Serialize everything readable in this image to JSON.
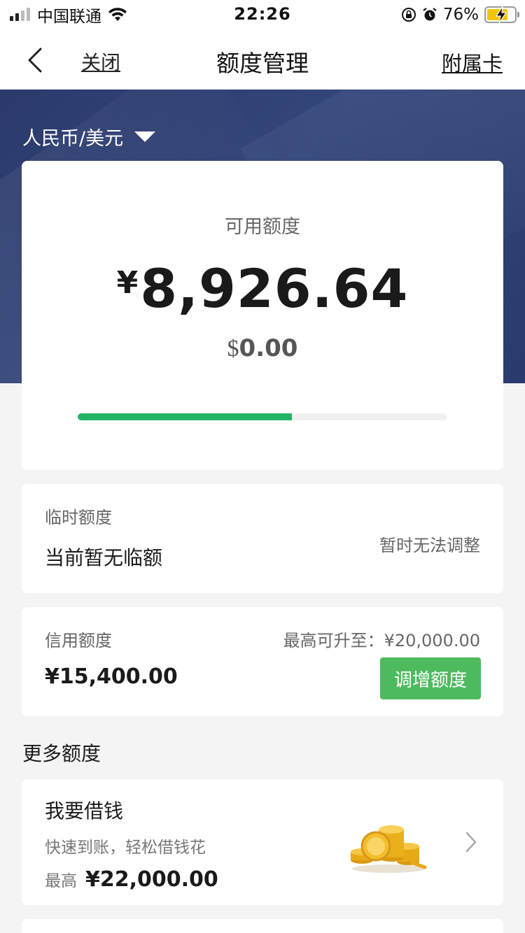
{
  "status_bar": {
    "carrier": "中国联通",
    "time": "22:26",
    "battery_percent": "76%",
    "battery_level": 0.76,
    "icons": [
      "signal-icon",
      "wifi-icon",
      "orientation-lock-icon",
      "alarm-icon",
      "battery-charging-icon"
    ]
  },
  "nav": {
    "close_label": "关闭",
    "title": "额度管理",
    "sub_card_label": "附属卡"
  },
  "hero": {
    "currency_label": "人民币/美元"
  },
  "available": {
    "label": "可用额度",
    "yen_symbol": "¥",
    "amount": "8,926.64",
    "usd_symbol": "$",
    "usd_amount": "0.00",
    "used_fraction": 0.58
  },
  "temporary": {
    "label": "临时额度",
    "value": "当前暂无临额",
    "status": "暂时无法调整"
  },
  "credit": {
    "label": "信用额度",
    "value": "¥15,400.00",
    "max_raise": "最高可升至：¥20,000.00",
    "raise_button": "调增额度"
  },
  "more": {
    "section_title": "更多额度",
    "loan_title": "我要借钱",
    "loan_subtitle": "快速到账，轻松借钱花",
    "loan_max_label": "最高",
    "loan_max_value": "¥22,000.00"
  },
  "colors": {
    "hero_blue": "#2f4174",
    "progress_green": "#22b465",
    "button_green": "#4dba5e",
    "background": "#f4f4f4"
  }
}
